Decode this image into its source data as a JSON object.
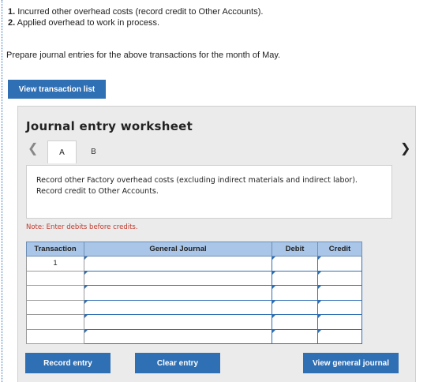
{
  "steps": [
    {
      "num": "1.",
      "text": "Incurred other overhead costs (record credit to Other Accounts)."
    },
    {
      "num": "2.",
      "text": "Applied overhead to work in process."
    }
  ],
  "prompt": "Prepare journal entries for the above transactions for the month of May.",
  "view_transaction_list": "View transaction list",
  "worksheet": {
    "title": "Journal entry worksheet",
    "tabs": [
      "A",
      "B"
    ],
    "prev_icon": "chevron-left-icon",
    "next_icon": "chevron-right-icon",
    "description": "Record other Factory overhead costs (excluding indirect materials and indirect labor). Record credit to Other Accounts.",
    "note": "Note: Enter debits before credits.",
    "table": {
      "headers": [
        "Transaction",
        "General Journal",
        "Debit",
        "Credit"
      ],
      "rows": [
        {
          "transaction": "1",
          "account": "",
          "debit": "",
          "credit": ""
        },
        {
          "transaction": "",
          "account": "",
          "debit": "",
          "credit": ""
        },
        {
          "transaction": "",
          "account": "",
          "debit": "",
          "credit": ""
        },
        {
          "transaction": "",
          "account": "",
          "debit": "",
          "credit": ""
        },
        {
          "transaction": "",
          "account": "",
          "debit": "",
          "credit": ""
        },
        {
          "transaction": "",
          "account": "",
          "debit": "",
          "credit": ""
        }
      ]
    },
    "buttons": {
      "record": "Record entry",
      "clear": "Clear entry",
      "general": "View general journal"
    }
  },
  "colors": {
    "accent": "#2f6fb4",
    "header": "#a9c6e8",
    "note": "#c0392b"
  }
}
